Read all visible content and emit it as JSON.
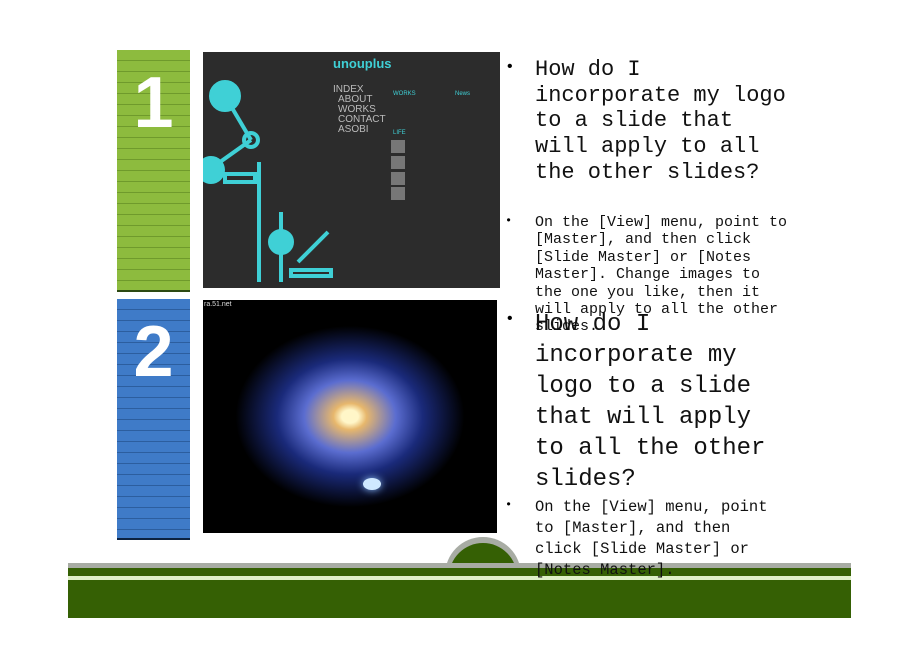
{
  "blocks": [
    {
      "number": "1",
      "color": "#8dbb3e"
    },
    {
      "number": "2",
      "color": "#3f7bc8"
    }
  ],
  "images": [
    {
      "logo": "unouplus",
      "menu": [
        "INDEX",
        "ABOUT",
        "WORKS",
        "CONTACT",
        "ASOBI"
      ],
      "sections": [
        "WORKS",
        "LIFE",
        "News"
      ]
    },
    {
      "watermark": "ra.51.net"
    }
  ],
  "content": [
    {
      "question": "How do I incorporate my logo to a slide that will apply to all the other slides?",
      "answer": "On the [View] menu, point to [Master], and then click [Slide Master] or [Notes Master]. Change images to the one you like, then it will apply to all the other slides."
    },
    {
      "question": "How do I incorporate my logo to a slide that will apply to all the other slides?",
      "answer": "On the [View] menu, point to [Master], and then click [Slide Master] or [Notes Master]."
    }
  ],
  "bullet": "•",
  "colors": {
    "band_green": "#356004",
    "band_gray": "#a8aca4",
    "band_light": "#dff0c8"
  }
}
